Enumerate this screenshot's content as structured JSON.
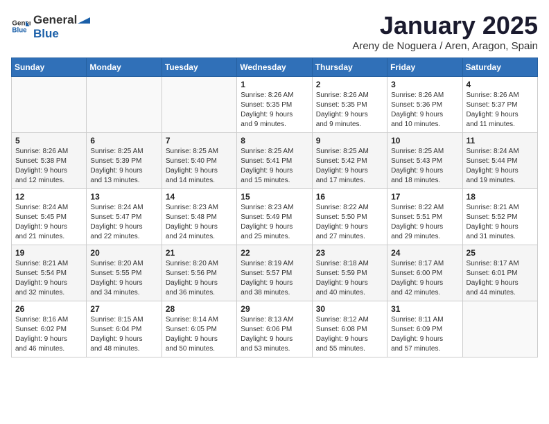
{
  "logo": {
    "general": "General",
    "blue": "Blue"
  },
  "title": "January 2025",
  "subtitle": "Areny de Noguera / Aren, Aragon, Spain",
  "days_header": [
    "Sunday",
    "Monday",
    "Tuesday",
    "Wednesday",
    "Thursday",
    "Friday",
    "Saturday"
  ],
  "weeks": [
    [
      {
        "day": "",
        "info": ""
      },
      {
        "day": "",
        "info": ""
      },
      {
        "day": "",
        "info": ""
      },
      {
        "day": "1",
        "info": "Sunrise: 8:26 AM\nSunset: 5:35 PM\nDaylight: 9 hours\nand 9 minutes."
      },
      {
        "day": "2",
        "info": "Sunrise: 8:26 AM\nSunset: 5:35 PM\nDaylight: 9 hours\nand 9 minutes."
      },
      {
        "day": "3",
        "info": "Sunrise: 8:26 AM\nSunset: 5:36 PM\nDaylight: 9 hours\nand 10 minutes."
      },
      {
        "day": "4",
        "info": "Sunrise: 8:26 AM\nSunset: 5:37 PM\nDaylight: 9 hours\nand 11 minutes."
      }
    ],
    [
      {
        "day": "5",
        "info": "Sunrise: 8:26 AM\nSunset: 5:38 PM\nDaylight: 9 hours\nand 12 minutes."
      },
      {
        "day": "6",
        "info": "Sunrise: 8:25 AM\nSunset: 5:39 PM\nDaylight: 9 hours\nand 13 minutes."
      },
      {
        "day": "7",
        "info": "Sunrise: 8:25 AM\nSunset: 5:40 PM\nDaylight: 9 hours\nand 14 minutes."
      },
      {
        "day": "8",
        "info": "Sunrise: 8:25 AM\nSunset: 5:41 PM\nDaylight: 9 hours\nand 15 minutes."
      },
      {
        "day": "9",
        "info": "Sunrise: 8:25 AM\nSunset: 5:42 PM\nDaylight: 9 hours\nand 17 minutes."
      },
      {
        "day": "10",
        "info": "Sunrise: 8:25 AM\nSunset: 5:43 PM\nDaylight: 9 hours\nand 18 minutes."
      },
      {
        "day": "11",
        "info": "Sunrise: 8:24 AM\nSunset: 5:44 PM\nDaylight: 9 hours\nand 19 minutes."
      }
    ],
    [
      {
        "day": "12",
        "info": "Sunrise: 8:24 AM\nSunset: 5:45 PM\nDaylight: 9 hours\nand 21 minutes."
      },
      {
        "day": "13",
        "info": "Sunrise: 8:24 AM\nSunset: 5:47 PM\nDaylight: 9 hours\nand 22 minutes."
      },
      {
        "day": "14",
        "info": "Sunrise: 8:23 AM\nSunset: 5:48 PM\nDaylight: 9 hours\nand 24 minutes."
      },
      {
        "day": "15",
        "info": "Sunrise: 8:23 AM\nSunset: 5:49 PM\nDaylight: 9 hours\nand 25 minutes."
      },
      {
        "day": "16",
        "info": "Sunrise: 8:22 AM\nSunset: 5:50 PM\nDaylight: 9 hours\nand 27 minutes."
      },
      {
        "day": "17",
        "info": "Sunrise: 8:22 AM\nSunset: 5:51 PM\nDaylight: 9 hours\nand 29 minutes."
      },
      {
        "day": "18",
        "info": "Sunrise: 8:21 AM\nSunset: 5:52 PM\nDaylight: 9 hours\nand 31 minutes."
      }
    ],
    [
      {
        "day": "19",
        "info": "Sunrise: 8:21 AM\nSunset: 5:54 PM\nDaylight: 9 hours\nand 32 minutes."
      },
      {
        "day": "20",
        "info": "Sunrise: 8:20 AM\nSunset: 5:55 PM\nDaylight: 9 hours\nand 34 minutes."
      },
      {
        "day": "21",
        "info": "Sunrise: 8:20 AM\nSunset: 5:56 PM\nDaylight: 9 hours\nand 36 minutes."
      },
      {
        "day": "22",
        "info": "Sunrise: 8:19 AM\nSunset: 5:57 PM\nDaylight: 9 hours\nand 38 minutes."
      },
      {
        "day": "23",
        "info": "Sunrise: 8:18 AM\nSunset: 5:59 PM\nDaylight: 9 hours\nand 40 minutes."
      },
      {
        "day": "24",
        "info": "Sunrise: 8:17 AM\nSunset: 6:00 PM\nDaylight: 9 hours\nand 42 minutes."
      },
      {
        "day": "25",
        "info": "Sunrise: 8:17 AM\nSunset: 6:01 PM\nDaylight: 9 hours\nand 44 minutes."
      }
    ],
    [
      {
        "day": "26",
        "info": "Sunrise: 8:16 AM\nSunset: 6:02 PM\nDaylight: 9 hours\nand 46 minutes."
      },
      {
        "day": "27",
        "info": "Sunrise: 8:15 AM\nSunset: 6:04 PM\nDaylight: 9 hours\nand 48 minutes."
      },
      {
        "day": "28",
        "info": "Sunrise: 8:14 AM\nSunset: 6:05 PM\nDaylight: 9 hours\nand 50 minutes."
      },
      {
        "day": "29",
        "info": "Sunrise: 8:13 AM\nSunset: 6:06 PM\nDaylight: 9 hours\nand 53 minutes."
      },
      {
        "day": "30",
        "info": "Sunrise: 8:12 AM\nSunset: 6:08 PM\nDaylight: 9 hours\nand 55 minutes."
      },
      {
        "day": "31",
        "info": "Sunrise: 8:11 AM\nSunset: 6:09 PM\nDaylight: 9 hours\nand 57 minutes."
      },
      {
        "day": "",
        "info": ""
      }
    ]
  ]
}
